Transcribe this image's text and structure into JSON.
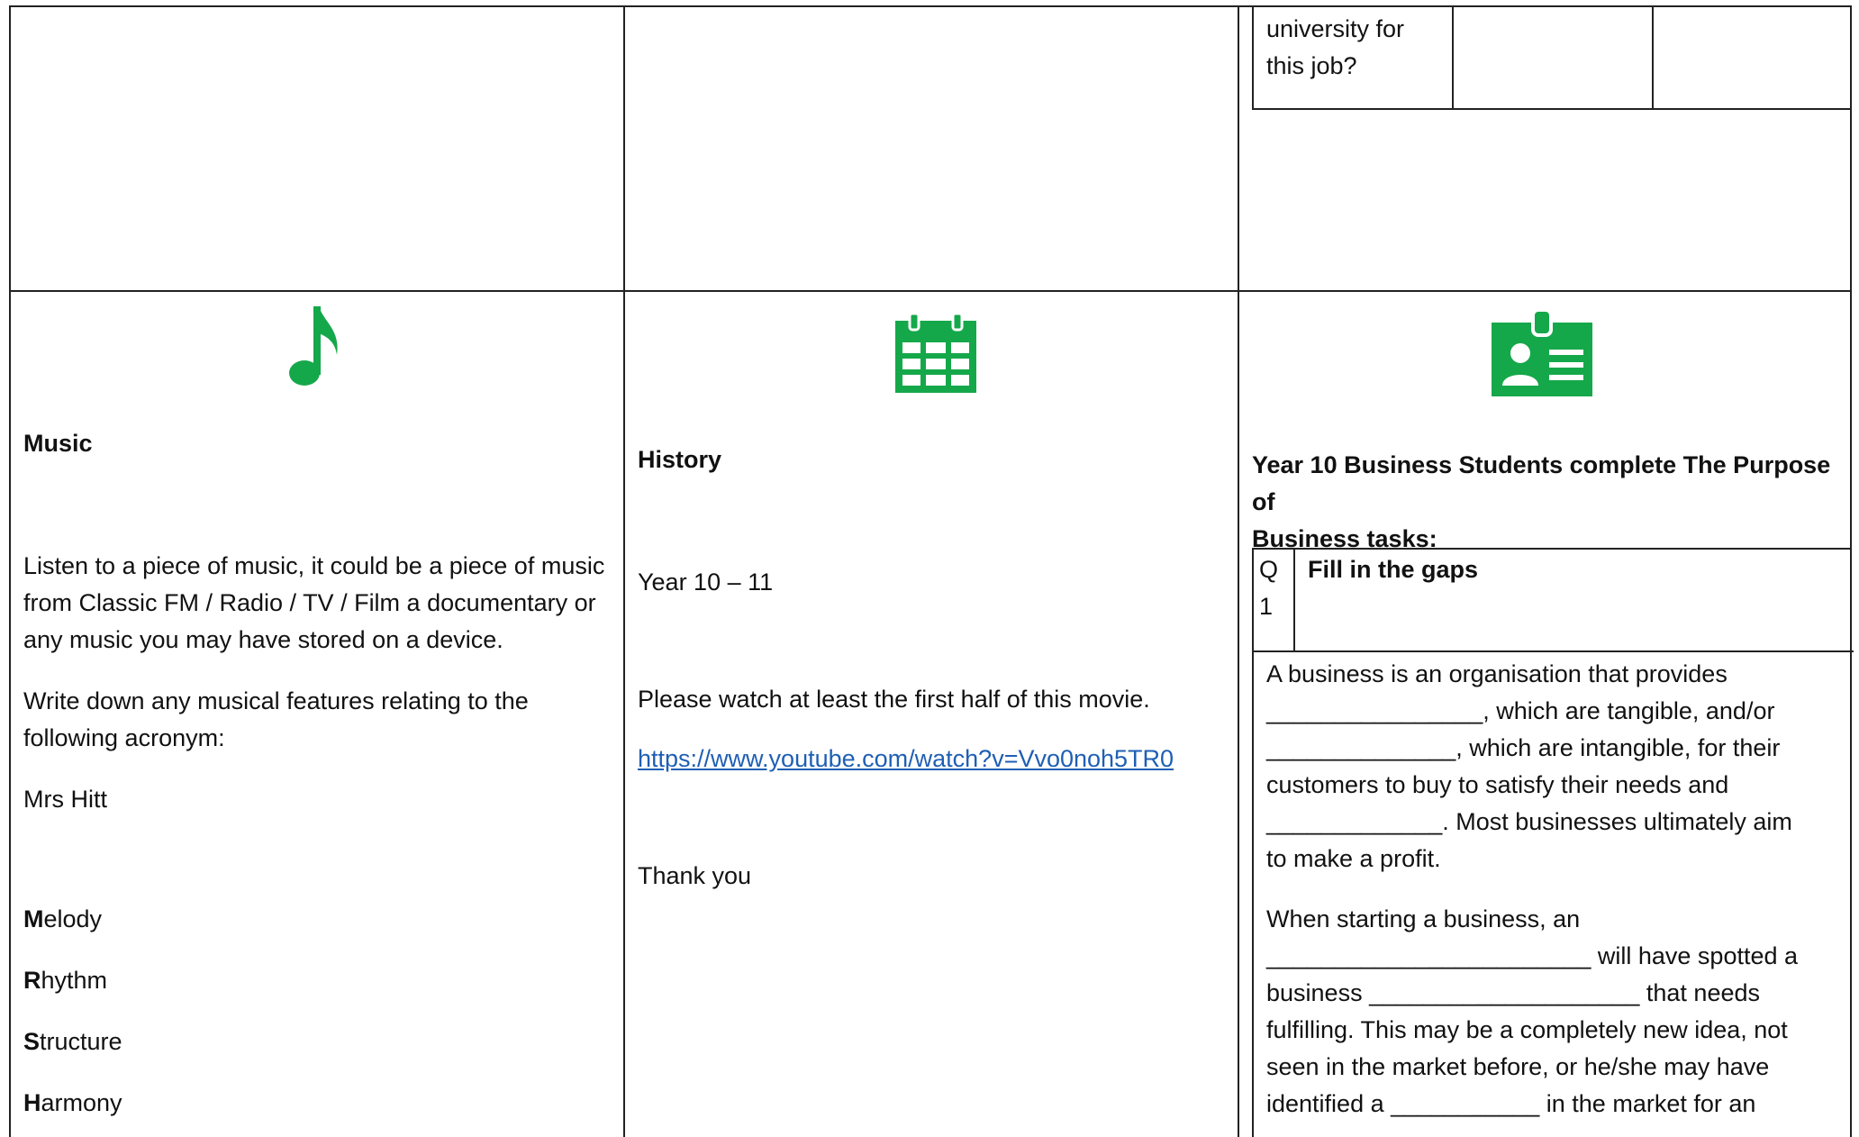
{
  "top_right_cell": {
    "text_line1": "university for",
    "text_line2": "this job?"
  },
  "music": {
    "icon": "music-note-icon",
    "title": "Music",
    "para1_line1": "Listen to a piece of music, it could be a piece of music",
    "para1_line2": "from Classic FM / Radio / TV / Film a documentary or",
    "para1_line3": "any music you may have stored on a device.",
    "para2_line1": "Write down any musical features relating to the",
    "para2_line2": "following acronym:",
    "teacher": "Mrs Hitt",
    "acronym": [
      {
        "letter": "M",
        "rest": "elody"
      },
      {
        "letter": "R",
        "rest": "hythm"
      },
      {
        "letter": "S",
        "rest": "tructure"
      },
      {
        "letter": "H",
        "rest": "armony"
      }
    ]
  },
  "history": {
    "icon": "calendar-icon",
    "title": "History",
    "year": "Year 10 – 11",
    "instruction": "Please watch at least the first half of this movie.",
    "link": "https://www.youtube.com/watch?v=Vvo0noh5TR0",
    "thanks": "Thank you"
  },
  "business": {
    "icon": "id-badge-icon",
    "heading_line1": "Year 10 Business Students complete The Purpose of",
    "heading_line2": "Business tasks:",
    "q_line1": "Q",
    "q_line2": "1",
    "task_title": "Fill in the gaps",
    "p1_l1": "A business is an organisation that provides",
    "p1_l2": "________________, which are tangible, and/or",
    "p1_l3": "______________, which are intangible, for their",
    "p1_l4": "customers to buy to satisfy their needs and",
    "p1_l5": "_____________. Most businesses ultimately aim",
    "p1_l6": "to make a profit.",
    "p2_l1": "When starting a business, an",
    "p2_l2": "________________________ will have spotted a",
    "p2_l3": "business ____________________ that needs",
    "p2_l4": "fulfilling. This may be a completely new idea, not",
    "p2_l5": "seen in the market before, or he/she may have",
    "p2_l6": "identified a ___________ in the market for an"
  },
  "colors": {
    "icon_green": "#15a84a",
    "link_blue": "#1f5fb4",
    "border": "#222222"
  }
}
